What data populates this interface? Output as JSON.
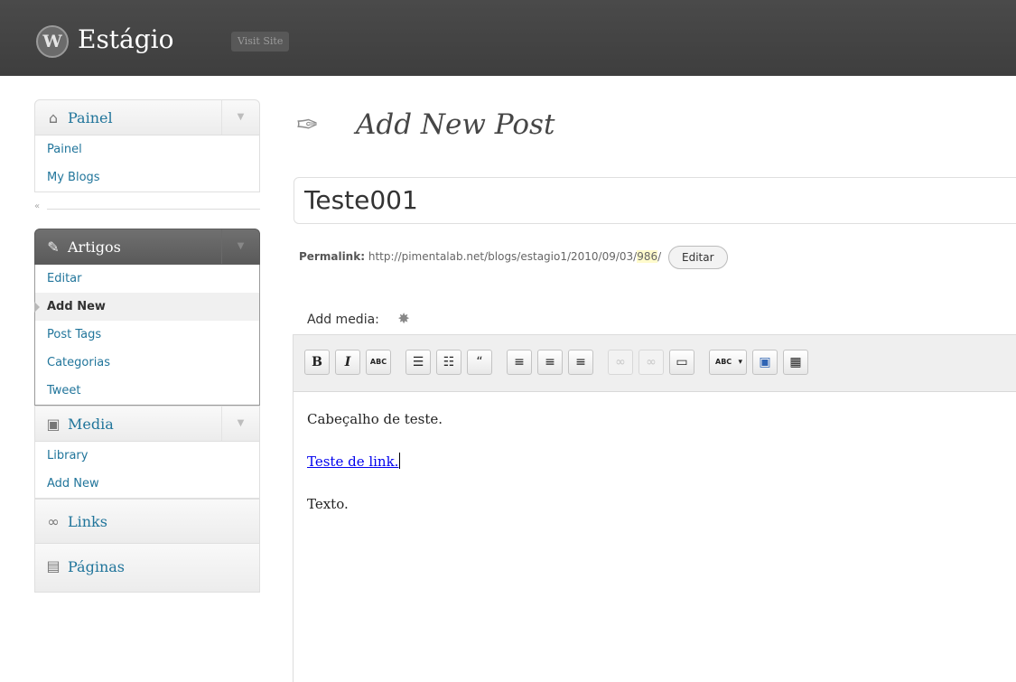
{
  "header": {
    "site_title": "Estágio",
    "visit_site": "Visit Site",
    "logo_letter": "W"
  },
  "menu": {
    "painel": {
      "label": "Painel",
      "items": [
        "Painel",
        "My Blogs"
      ]
    },
    "collapse": "«",
    "artigos": {
      "label": "Artigos",
      "items": [
        "Editar",
        "Add New",
        "Post Tags",
        "Categorias",
        "Tweet"
      ],
      "current": "Add New"
    },
    "media": {
      "label": "Media",
      "items": [
        "Library",
        "Add New"
      ]
    },
    "links": {
      "label": "Links"
    },
    "paginas": {
      "label": "Páginas"
    }
  },
  "page": {
    "title": "Add New Post",
    "post_title": "Teste001",
    "permalink_label": "Permalink:",
    "permalink_base": "http://pimentalab.net/blogs/estagio1/2010/09/03/",
    "permalink_slug": "986",
    "permalink_trailing": "/",
    "edit_button": "Editar",
    "add_media_label": "Add media:"
  },
  "toolbar": {
    "bold": "B",
    "italic": "I",
    "strikethrough": "ABC",
    "bullist": "☰",
    "numlist": "☷",
    "blockquote": "“",
    "align_left": "≡",
    "align_center": "≡",
    "align_right": "≡",
    "link": "∞",
    "unlink": "∞",
    "more": "▭",
    "spellcheck": "ABC",
    "spellcheck_dropdown": "▾",
    "fullscreen": "▣",
    "kitchen_sink": "▦"
  },
  "editor": {
    "heading": "Cabeçalho de teste.",
    "link_text": "Teste de link.",
    "body": "Texto."
  },
  "colors": {
    "header_bg": "#464646",
    "link_blue": "#21759b",
    "active_menu_bg": "#6d6d6d",
    "slug_highlight": "#fffbcc"
  }
}
